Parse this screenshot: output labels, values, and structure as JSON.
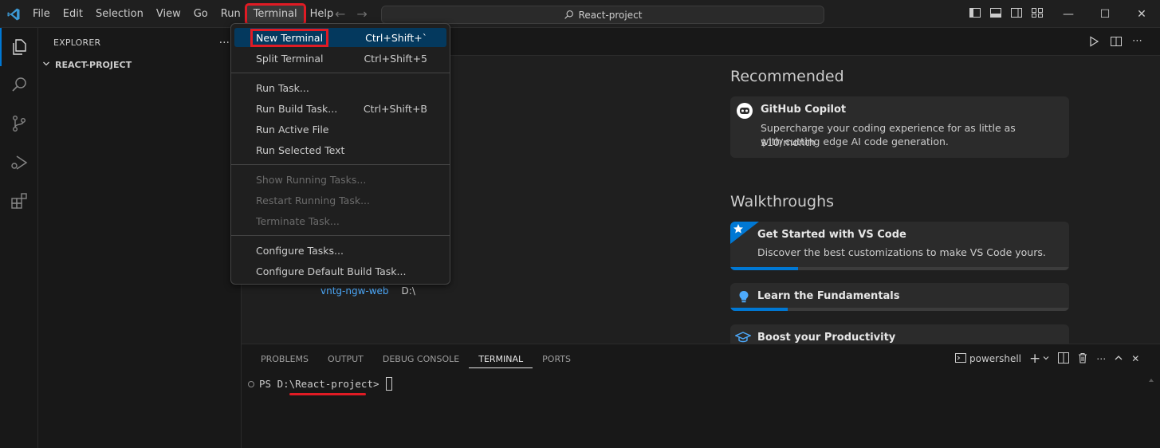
{
  "window": {
    "title": "React-project"
  },
  "menubar": {
    "items": [
      "File",
      "Edit",
      "Selection",
      "View",
      "Go",
      "Run",
      "Terminal",
      "Help"
    ],
    "highlighted": "Terminal"
  },
  "sidebar": {
    "title": "EXPLORER",
    "more": "...",
    "section": "REACT-PROJECT"
  },
  "terminal_menu": {
    "items": [
      {
        "label": "New Terminal",
        "shortcut": "Ctrl+Shift+`"
      },
      {
        "label": "Split Terminal",
        "shortcut": "Ctrl+Shift+5"
      },
      {
        "label": "Run Task...",
        "shortcut": ""
      },
      {
        "label": "Run Build Task...",
        "shortcut": "Ctrl+Shift+B"
      },
      {
        "label": "Run Active File",
        "shortcut": ""
      },
      {
        "label": "Run Selected Text",
        "shortcut": ""
      },
      {
        "label": "Show Running Tasks...",
        "shortcut": ""
      },
      {
        "label": "Restart Running Task...",
        "shortcut": ""
      },
      {
        "label": "Terminate Task...",
        "shortcut": ""
      },
      {
        "label": "Configure Tasks...",
        "shortcut": ""
      },
      {
        "label": "Configure Default Build Task...",
        "shortcut": ""
      }
    ]
  },
  "welcome": {
    "recent": {
      "name": "vntg-ngw-web",
      "path": "D:\\"
    },
    "recommended": {
      "heading": "Recommended",
      "card_title": "GitHub Copilot",
      "card_desc_1": "Supercharge your coding experience for as little as $10/month",
      "card_desc_2": "with cutting edge AI code generation."
    },
    "walkthroughs": {
      "heading": "Walkthroughs",
      "items": [
        {
          "title": "Get Started with VS Code",
          "desc": "Discover the best customizations to make VS Code yours.",
          "progress": 0.2
        },
        {
          "title": "Learn the Fundamentals",
          "desc": "",
          "progress": 0.17
        },
        {
          "title": "Boost your Productivity",
          "desc": "",
          "progress": 0
        }
      ]
    }
  },
  "panel": {
    "tabs": [
      "PROBLEMS",
      "OUTPUT",
      "DEBUG CONSOLE",
      "TERMINAL",
      "PORTS"
    ],
    "active_tab": "TERMINAL",
    "shell": "powershell",
    "prompt": "PS D:\\React-project>"
  },
  "colors": {
    "accent": "#0078d4",
    "highlight_box": "#e01b24",
    "link": "#4daafc"
  }
}
